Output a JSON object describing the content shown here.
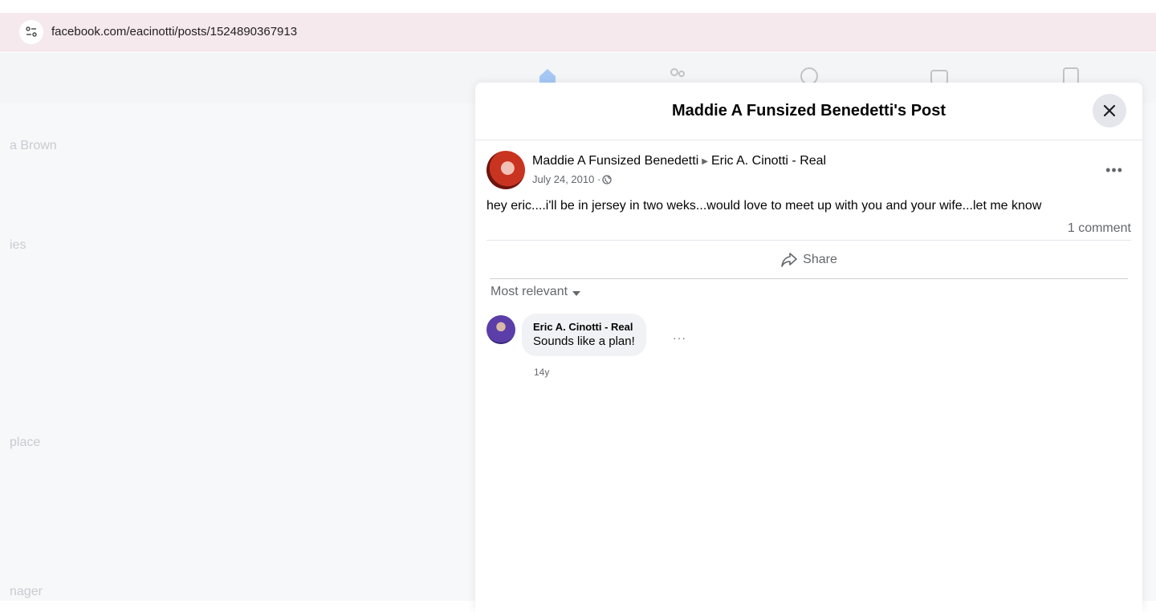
{
  "browser": {
    "url": "facebook.com/eacinotti/posts/1524890367913"
  },
  "background": {
    "sidebar_fragments": [
      "a Brown",
      "ies",
      "place",
      "nager"
    ]
  },
  "modal": {
    "title": "Maddie A Funsized Benedetti's Post",
    "post": {
      "author": "Maddie A Funsized Benedetti",
      "recipient": "Eric A. Cinotti - Real",
      "date": "July 24, 2010 · ",
      "privacy_icon": "globe-icon",
      "text": "hey eric....i'll be in jersey in two weks...would love to meet up with you and your wife...let me know",
      "comment_count": "1 comment",
      "share_label": "Share"
    },
    "comments_sort": "Most relevant",
    "comments": [
      {
        "author": "Eric A. Cinotti - Real",
        "text": "Sounds like a plan!",
        "age": "14y"
      }
    ]
  },
  "colors": {
    "address_bar_bg": "#f6e9ee",
    "secondary_text": "#65676b",
    "divider": "#e4e6eb"
  }
}
